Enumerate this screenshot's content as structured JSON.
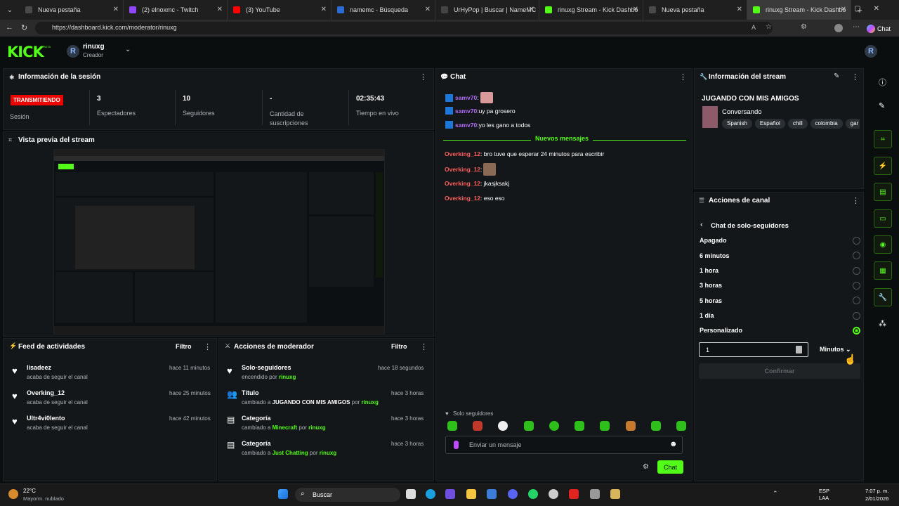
{
  "browser": {
    "tabs": [
      {
        "title": "Nueva pestaña",
        "color": "#4a4a4a"
      },
      {
        "title": "(2) elnoxmc - Twitch",
        "color": "#9146ff"
      },
      {
        "title": "(3) YouTube",
        "color": "#ff0000"
      },
      {
        "title": "namemc - Búsqueda",
        "color": "#2b6cd4"
      },
      {
        "title": "UrHyPop | Buscar | NameMC",
        "color": "#444444"
      },
      {
        "title": "rinuxg Stream - Kick Dashbo",
        "color": "#53fc18"
      },
      {
        "title": "Nueva pestaña",
        "color": "#4a4a4a"
      },
      {
        "title": "rinuxg Stream - Kick Dashbo",
        "color": "#53fc18"
      }
    ],
    "url": "https://dashboard.kick.com/moderator/rinuxg",
    "chat_btn": "Chat"
  },
  "kick": {
    "logo": "KICK",
    "beta": "BETA",
    "user": {
      "initial": "R",
      "name": "rinuxg",
      "role": "Creador"
    }
  },
  "session": {
    "title": "Información de la sesión",
    "badge": "TRANSMITIENDO",
    "badge_label": "Sesión",
    "stats": [
      {
        "value": "3",
        "label": "Espectadores"
      },
      {
        "value": "10",
        "label": "Seguidores"
      },
      {
        "value": "-",
        "label": "Cantidad de suscripciones"
      },
      {
        "value": "02:35:43",
        "label": "Tiempo en vivo"
      }
    ]
  },
  "preview": {
    "title": "Vista previa del stream"
  },
  "feed": {
    "title": "Feed de actividades",
    "filter": "Filtro",
    "items": [
      {
        "name": "lisadeez",
        "desc": "acaba de seguir el canal",
        "time": "hace 11 minutos"
      },
      {
        "name": "Overking_12",
        "desc": "acaba de seguir el canal",
        "time": "hace 25 minutos"
      },
      {
        "name": "Ultr4vi0lento",
        "desc": "acaba de seguir el canal",
        "time": "hace 42 minutos"
      }
    ]
  },
  "modactions": {
    "title": "Acciones de moderador",
    "filter": "Filtro",
    "items": [
      {
        "name": "Solo-seguidores",
        "pre": "encendido por ",
        "a": "rinuxg",
        "mid": "",
        "b": "",
        "time": "hace 18 segundos"
      },
      {
        "name": "Título",
        "pre": "cambiado a ",
        "a": "JUGANDO CON MIS AMIGOS",
        "mid": " por ",
        "b": "rinuxg",
        "time": "hace 3 horas"
      },
      {
        "name": "Categoría",
        "pre": "cambiado a ",
        "a": "Minecraft",
        "mid": " por ",
        "b": "rinuxg",
        "time": "hace 3 horas"
      },
      {
        "name": "Categoría",
        "pre": "cambiado a ",
        "a": "Just Chatting",
        "mid": " por ",
        "b": "rinuxg",
        "time": "hace 3 horas"
      }
    ]
  },
  "chat": {
    "title": "Chat",
    "messages": [
      {
        "user": "samv70",
        "text": ""
      },
      {
        "user": "samv70",
        "text": "uy pa grosero"
      },
      {
        "user": "samv70",
        "text": "yo les gano a todos"
      }
    ],
    "new_label": "Nuevos mensajes",
    "new_messages": [
      {
        "user": "Overking_12",
        "text": "bro tuve que esperar 24 minutos para escribir"
      },
      {
        "user": "Overking_12",
        "text": ""
      },
      {
        "user": "Overking_12",
        "text": "jkasjksakj"
      },
      {
        "user": "Overking_12",
        "text": "eso eso"
      }
    ],
    "mode": "Solo seguidores",
    "placeholder": "Enviar un mensaje",
    "send": "Chat"
  },
  "stream_info": {
    "title": "Información del stream",
    "stream_title": "JUGANDO CON MIS AMIGOS",
    "category": "Conversando",
    "tags": [
      "Spanish",
      "Español",
      "chill",
      "colombia",
      "gar"
    ]
  },
  "channel_actions": {
    "title": "Acciones de canal",
    "sub_title": "Chat de solo-seguidores",
    "options": [
      "Apagado",
      "6 minutos",
      "1 hora",
      "3 horas",
      "5 horas",
      "1 día",
      "Personalizado"
    ],
    "selected": 6,
    "custom_value": "1",
    "unit": "Minutos",
    "confirm": "Confirmar"
  },
  "taskbar": {
    "temp": "22°C",
    "weather": "Mayorm. nublado",
    "search": "Buscar",
    "lang1": "ESP",
    "lang2": "LAA",
    "time": "7:07 p. m.",
    "date": "2/01/2026"
  },
  "colors": {
    "accent": "#53fc18",
    "live": "#eb0400",
    "username": "#b46bff",
    "mod_user": "#ff5c5c"
  }
}
